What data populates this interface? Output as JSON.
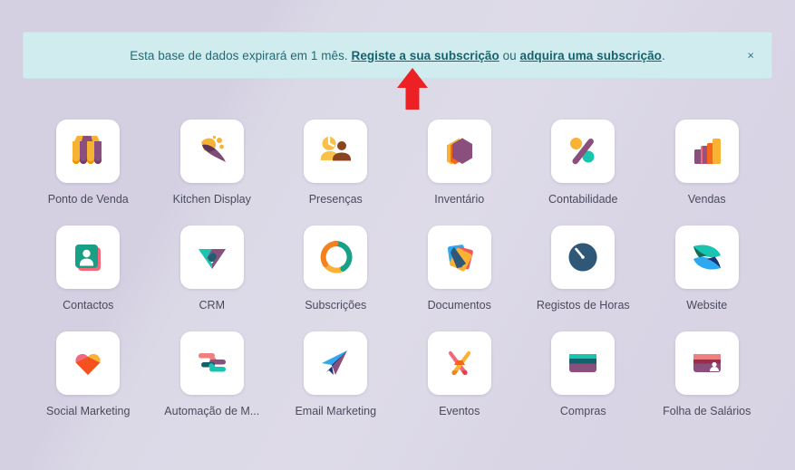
{
  "banner": {
    "message_prefix": "Esta base de dados expirará em 1 mês.",
    "link_register": "Registe a sua subscrição",
    "conjunction": "ou",
    "link_buy": "adquira uma subscrição",
    "period": ".",
    "close_label": "×",
    "background_color": "#d1ecef",
    "text_color": "#1f6b75"
  },
  "desktop": {
    "background_color": "#d6d2e4"
  },
  "annotation": {
    "arrow_color": "#ed2024",
    "arrow_name": "red-up-arrow"
  },
  "apps": [
    {
      "label": "Ponto de Venda",
      "icon": "point-of-sale-icon"
    },
    {
      "label": "Kitchen Display",
      "icon": "kitchen-display-icon"
    },
    {
      "label": "Presenças",
      "icon": "attendances-icon"
    },
    {
      "label": "Inventário",
      "icon": "inventory-icon"
    },
    {
      "label": "Contabilidade",
      "icon": "accounting-icon"
    },
    {
      "label": "Vendas",
      "icon": "sales-icon"
    },
    {
      "label": "Contactos",
      "icon": "contacts-icon"
    },
    {
      "label": "CRM",
      "icon": "crm-icon"
    },
    {
      "label": "Subscrições",
      "icon": "subscriptions-icon"
    },
    {
      "label": "Documentos",
      "icon": "documents-icon"
    },
    {
      "label": "Registos de Horas",
      "icon": "timesheets-icon"
    },
    {
      "label": "Website",
      "icon": "website-icon"
    },
    {
      "label": "Social Marketing",
      "icon": "social-marketing-icon"
    },
    {
      "label": "Automação de M...",
      "icon": "marketing-automation-icon"
    },
    {
      "label": "Email Marketing",
      "icon": "email-marketing-icon"
    },
    {
      "label": "Eventos",
      "icon": "events-icon"
    },
    {
      "label": "Compras",
      "icon": "purchase-icon"
    },
    {
      "label": "Folha de Salários",
      "icon": "payroll-icon"
    }
  ]
}
